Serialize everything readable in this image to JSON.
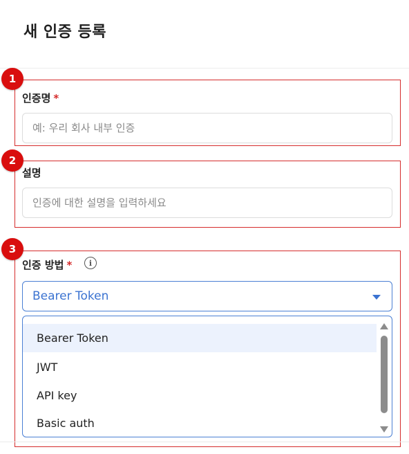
{
  "header": {
    "title": "새 인증 등록"
  },
  "badges": [
    "1",
    "2",
    "3"
  ],
  "name_field": {
    "label": "인증명",
    "required_mark": "*",
    "placeholder": "예: 우리 회사 내부 인증",
    "value": ""
  },
  "description_field": {
    "label": "설명",
    "placeholder": "인증에 대한 설명을 입력하세요",
    "value": ""
  },
  "auth_method": {
    "label": "인증 방법",
    "required_mark": "*",
    "info_icon": "info-icon",
    "selected": "Bearer Token",
    "options": [
      "Bearer Token",
      "JWT",
      "API key",
      "Basic auth"
    ]
  },
  "colors": {
    "accent": "#3b73d1",
    "required": "#d52b2b",
    "badge": "#d90e0e",
    "highlight": "#ecf2fd"
  }
}
